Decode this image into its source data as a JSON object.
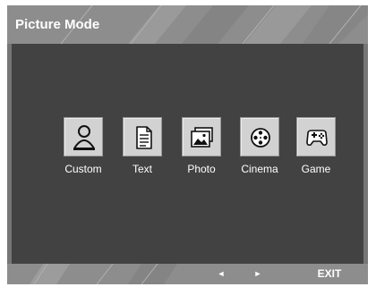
{
  "title": "Picture Mode",
  "modes": [
    {
      "label": "Custom",
      "icon": "person-icon"
    },
    {
      "label": "Text",
      "icon": "document-icon"
    },
    {
      "label": "Photo",
      "icon": "photo-icon"
    },
    {
      "label": "Cinema",
      "icon": "film-reel-icon"
    },
    {
      "label": "Game",
      "icon": "gamepad-icon"
    }
  ],
  "nav": {
    "left_glyph": "◄",
    "right_glyph": "►",
    "exit_label": "EXIT"
  },
  "colors": {
    "frame": "#767676",
    "bar": "#8d8d8d",
    "content": "#424242",
    "tile": "#d2d2d2"
  }
}
